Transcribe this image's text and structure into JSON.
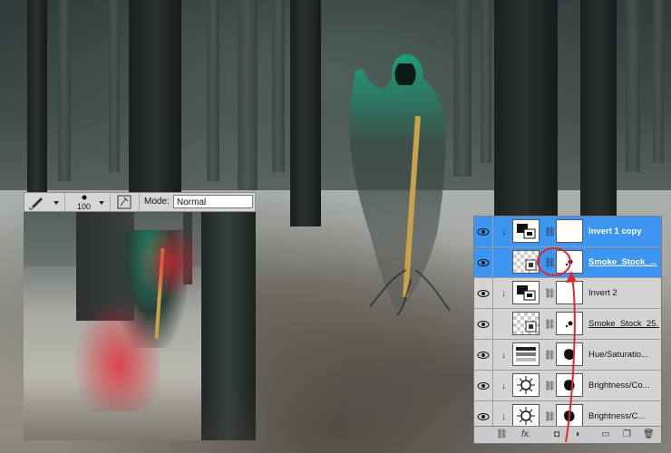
{
  "toolbar": {
    "brush_size": "100",
    "mode_label": "Mode:",
    "mode_value": "Normal"
  },
  "layers": [
    {
      "name": "Invert 1 copy",
      "selected": true,
      "clipped": true,
      "thumb": "invert",
      "mask": "white"
    },
    {
      "name": "Smoke_Stock_...",
      "selected": true,
      "clipped": false,
      "thumb": "smart",
      "mask": "smoke",
      "underline": true
    },
    {
      "name": "Invert 2",
      "selected": false,
      "clipped": true,
      "thumb": "invert",
      "mask": "white"
    },
    {
      "name": "Smoke_Stock_25...",
      "selected": false,
      "clipped": false,
      "thumb": "smart",
      "mask": "smoke",
      "underline": true
    },
    {
      "name": "Hue/Saturatio...",
      "selected": false,
      "clipped": true,
      "thumb": "hue",
      "mask": "blob"
    },
    {
      "name": "Brightness/Co...",
      "selected": false,
      "clipped": true,
      "thumb": "brightness",
      "mask": "blob"
    },
    {
      "name": "Brightness/C...",
      "selected": false,
      "clipped": true,
      "thumb": "brightness",
      "mask": "blob"
    }
  ],
  "footer": {
    "fx": "fx."
  },
  "annotation_color": "#e0262e"
}
